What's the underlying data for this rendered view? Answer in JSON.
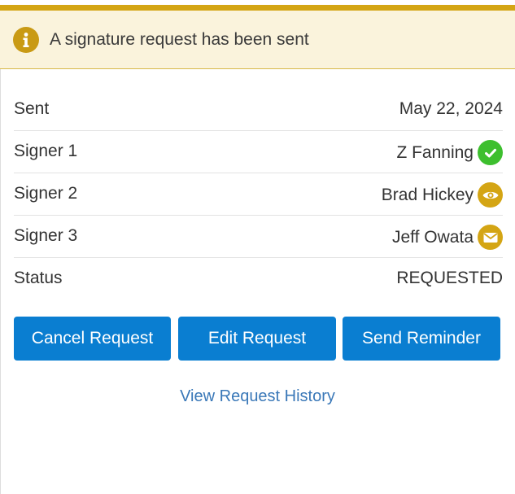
{
  "banner": {
    "icon": "info-icon",
    "message": "A signature request has been sent",
    "accent_color": "#d4a514"
  },
  "details": {
    "sent": {
      "label": "Sent",
      "value": "May 22, 2024"
    },
    "signers": [
      {
        "label": "Signer 1",
        "name": "Z Fanning",
        "status_icon": "check-circle-icon",
        "color": "#3dbf2e"
      },
      {
        "label": "Signer 2",
        "name": "Brad Hickey",
        "status_icon": "eye-icon",
        "color": "#d4a514"
      },
      {
        "label": "Signer 3",
        "name": "Jeff Owata",
        "status_icon": "envelope-icon",
        "color": "#d4a514"
      }
    ],
    "status": {
      "label": "Status",
      "value": "REQUESTED"
    }
  },
  "actions": {
    "cancel_label": "Cancel Request",
    "edit_label": "Edit Request",
    "remind_label": "Send Reminder",
    "button_color": "#0a7ed1"
  },
  "history_link": "View Request History"
}
